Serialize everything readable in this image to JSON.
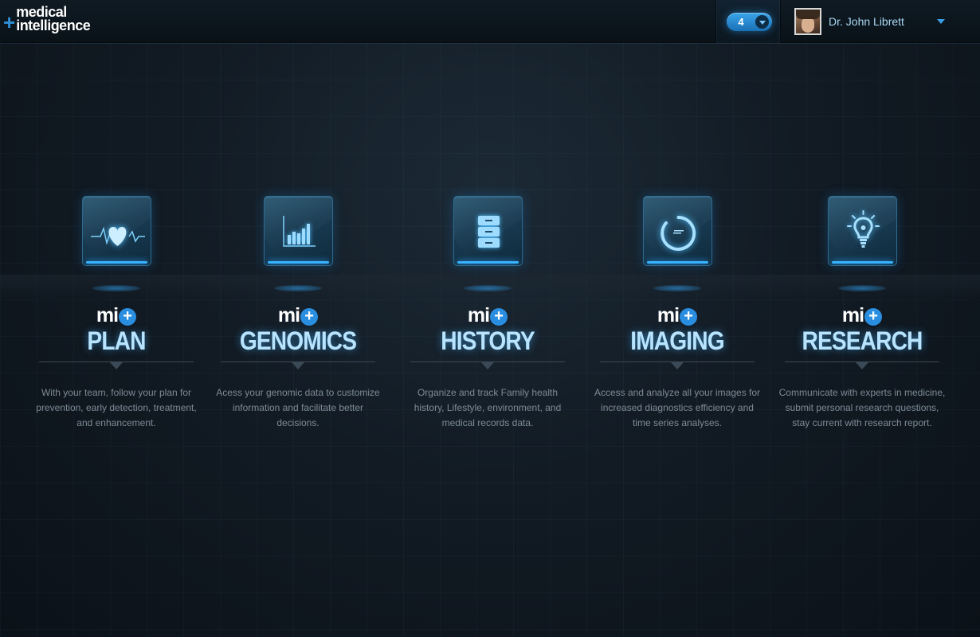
{
  "header": {
    "brand_line1": "medical",
    "brand_line2": "intelligence",
    "notifications": {
      "count": "4"
    },
    "user": {
      "name": "Dr. John Librett"
    }
  },
  "modules": [
    {
      "prefix": "mi",
      "title": "PLAN",
      "description": "With your team, follow your plan for prevention, early detection, treatment, and enhancement.",
      "icon": "heart-pulse-icon"
    },
    {
      "prefix": "mi",
      "title": "GENOMICS",
      "description": "Acess your genomic data to customize information and facilitate better decisions.",
      "icon": "bar-chart-icon"
    },
    {
      "prefix": "mi",
      "title": "HISTORY",
      "description": "Organize and track Family health history, Lifestyle, environment, and medical records data.",
      "icon": "file-cabinet-icon"
    },
    {
      "prefix": "mi",
      "title": "IMAGING",
      "description": "Access and analyze all your images for increased diagnostics efficiency and time series analyses.",
      "icon": "ring-scan-icon"
    },
    {
      "prefix": "mi",
      "title": "RESEARCH",
      "description": "Communicate with experts in medicine, submit personal research questions, stay current with research report.",
      "icon": "lightbulb-icon"
    }
  ],
  "colors": {
    "accent": "#2e8fd6",
    "title_glow": "#b8e4ff",
    "background": "#121b24"
  }
}
